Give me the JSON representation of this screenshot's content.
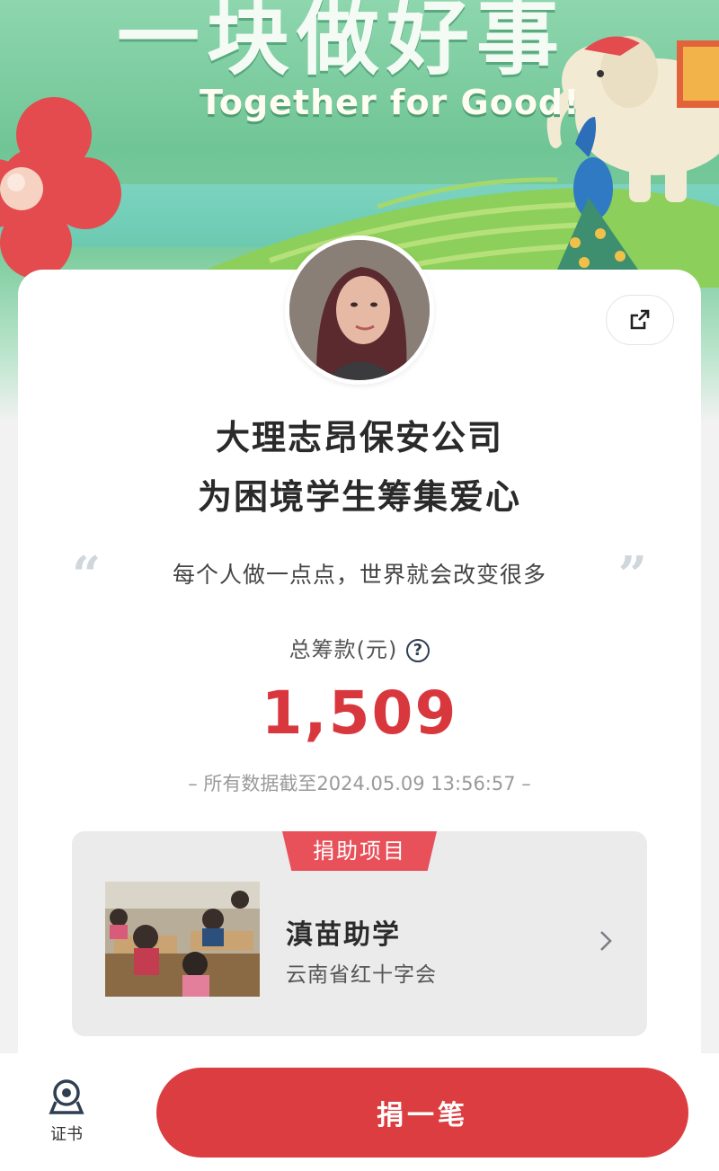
{
  "banner": {
    "title_cn": "一块做好事",
    "title_en": "Together for Good!"
  },
  "campaign": {
    "org_name": "大理志昂保安公司",
    "subtitle": "为困境学生筹集爱心",
    "quote": "每个人做一点点，世界就会改变很多",
    "quote_open": "“",
    "quote_close": "”"
  },
  "stats": {
    "total_label": "总筹款(元)",
    "help_symbol": "?",
    "total_amount": "1,509",
    "as_of": "– 所有数据截至2024.05.09 13:56:57 –"
  },
  "project": {
    "tag": "捐助项目",
    "name": "滇苗助学",
    "org": "云南省红十字会"
  },
  "bottom": {
    "certificate_label": "证书",
    "donate_label": "捐一笔"
  },
  "colors": {
    "accent_red": "#dc3d40",
    "amount_red": "#d8383d",
    "banner_green": "#70c596"
  },
  "icons": {
    "share": "share-icon",
    "help": "help-circle-icon",
    "chevron": "chevron-right-icon",
    "certificate": "certificate-icon"
  }
}
